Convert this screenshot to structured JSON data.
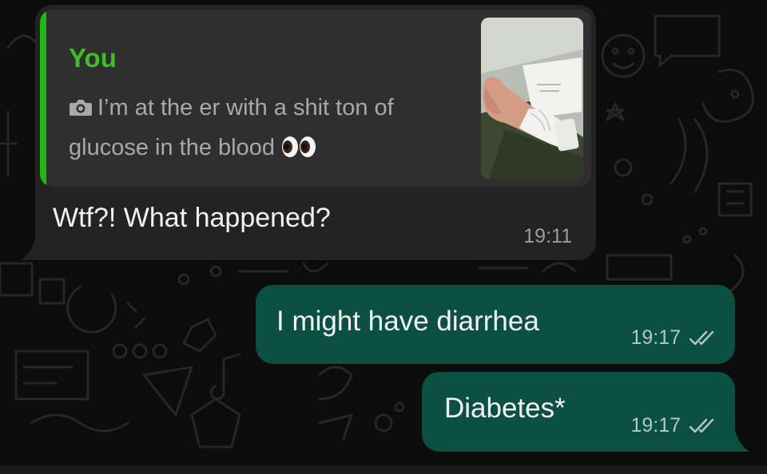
{
  "chat": {
    "messages": {
      "incoming": {
        "quote_author": "You",
        "quote_text": "I’m at the er with a shit ton of glucose in the blood",
        "text": "Wtf?! What happened?",
        "time": "19:11"
      },
      "outgoing_1": {
        "text": "I might have diarrhea",
        "time": "19:17"
      },
      "outgoing_2": {
        "text": "Diabetes*",
        "time": "19:17"
      }
    }
  },
  "icons": {
    "quote_media": "camera-icon",
    "quote_emoji": "eyes-emoji-icon",
    "read_receipt": "double-check-icon"
  },
  "colors": {
    "background": "#0c0c0c",
    "incoming_bubble": "#232323",
    "quote_background": "#2f2f30",
    "quote_accent": "#22b814",
    "quote_author": "#3fbd22",
    "outgoing_bubble": "#0c4f43",
    "read_ticks": "#b2c9c3"
  }
}
